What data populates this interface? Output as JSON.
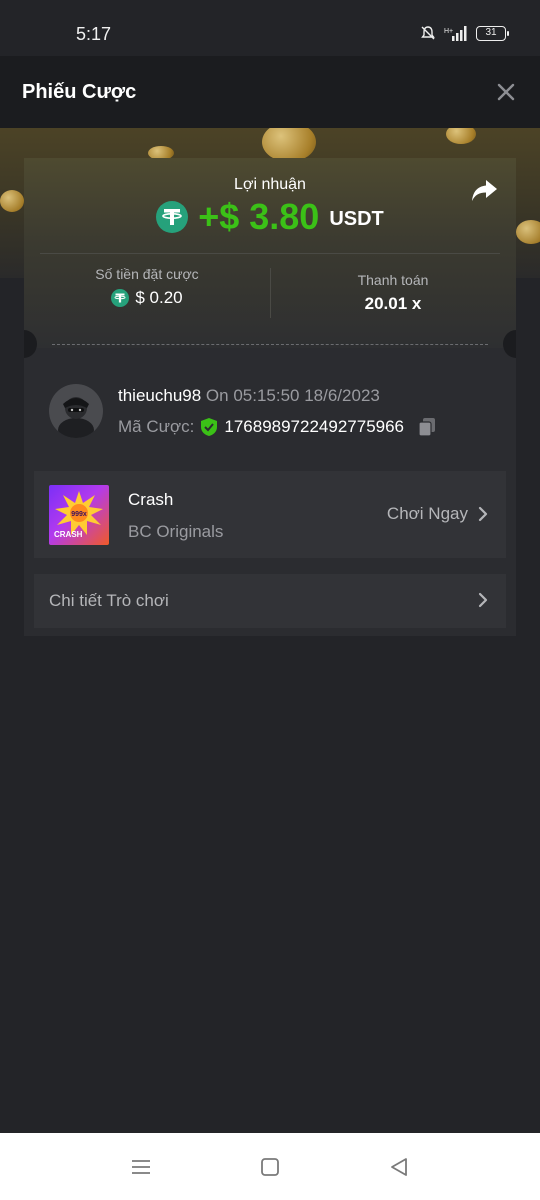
{
  "status_bar": {
    "time": "5:17",
    "battery": "31"
  },
  "header": {
    "title": "Phiếu Cược"
  },
  "profit": {
    "label": "Lợi nhuận",
    "amount": "+$ 3.80",
    "currency": "USDT"
  },
  "stats": {
    "bet_amount_label": "Số tiền đặt cược",
    "bet_amount_value": "$ 0.20",
    "payout_label": "Thanh toán",
    "payout_value": "20.01 x"
  },
  "bet": {
    "username": "thieuchu98",
    "timestamp": "On 05:15:50 18/6/2023",
    "bet_id_label": "Mã Cược:",
    "bet_id": "1768989722492775966"
  },
  "game": {
    "name": "Crash",
    "provider": "BC Originals",
    "play_label": "Chơi Ngay",
    "thumb_badge": "999x",
    "thumb_label": "CRASH"
  },
  "details": {
    "label": "Chi tiết Trò chơi"
  },
  "colors": {
    "profit_green": "#3bc117",
    "tether_green": "#26a17b",
    "background": "#232428",
    "card": "#2b2c30"
  }
}
